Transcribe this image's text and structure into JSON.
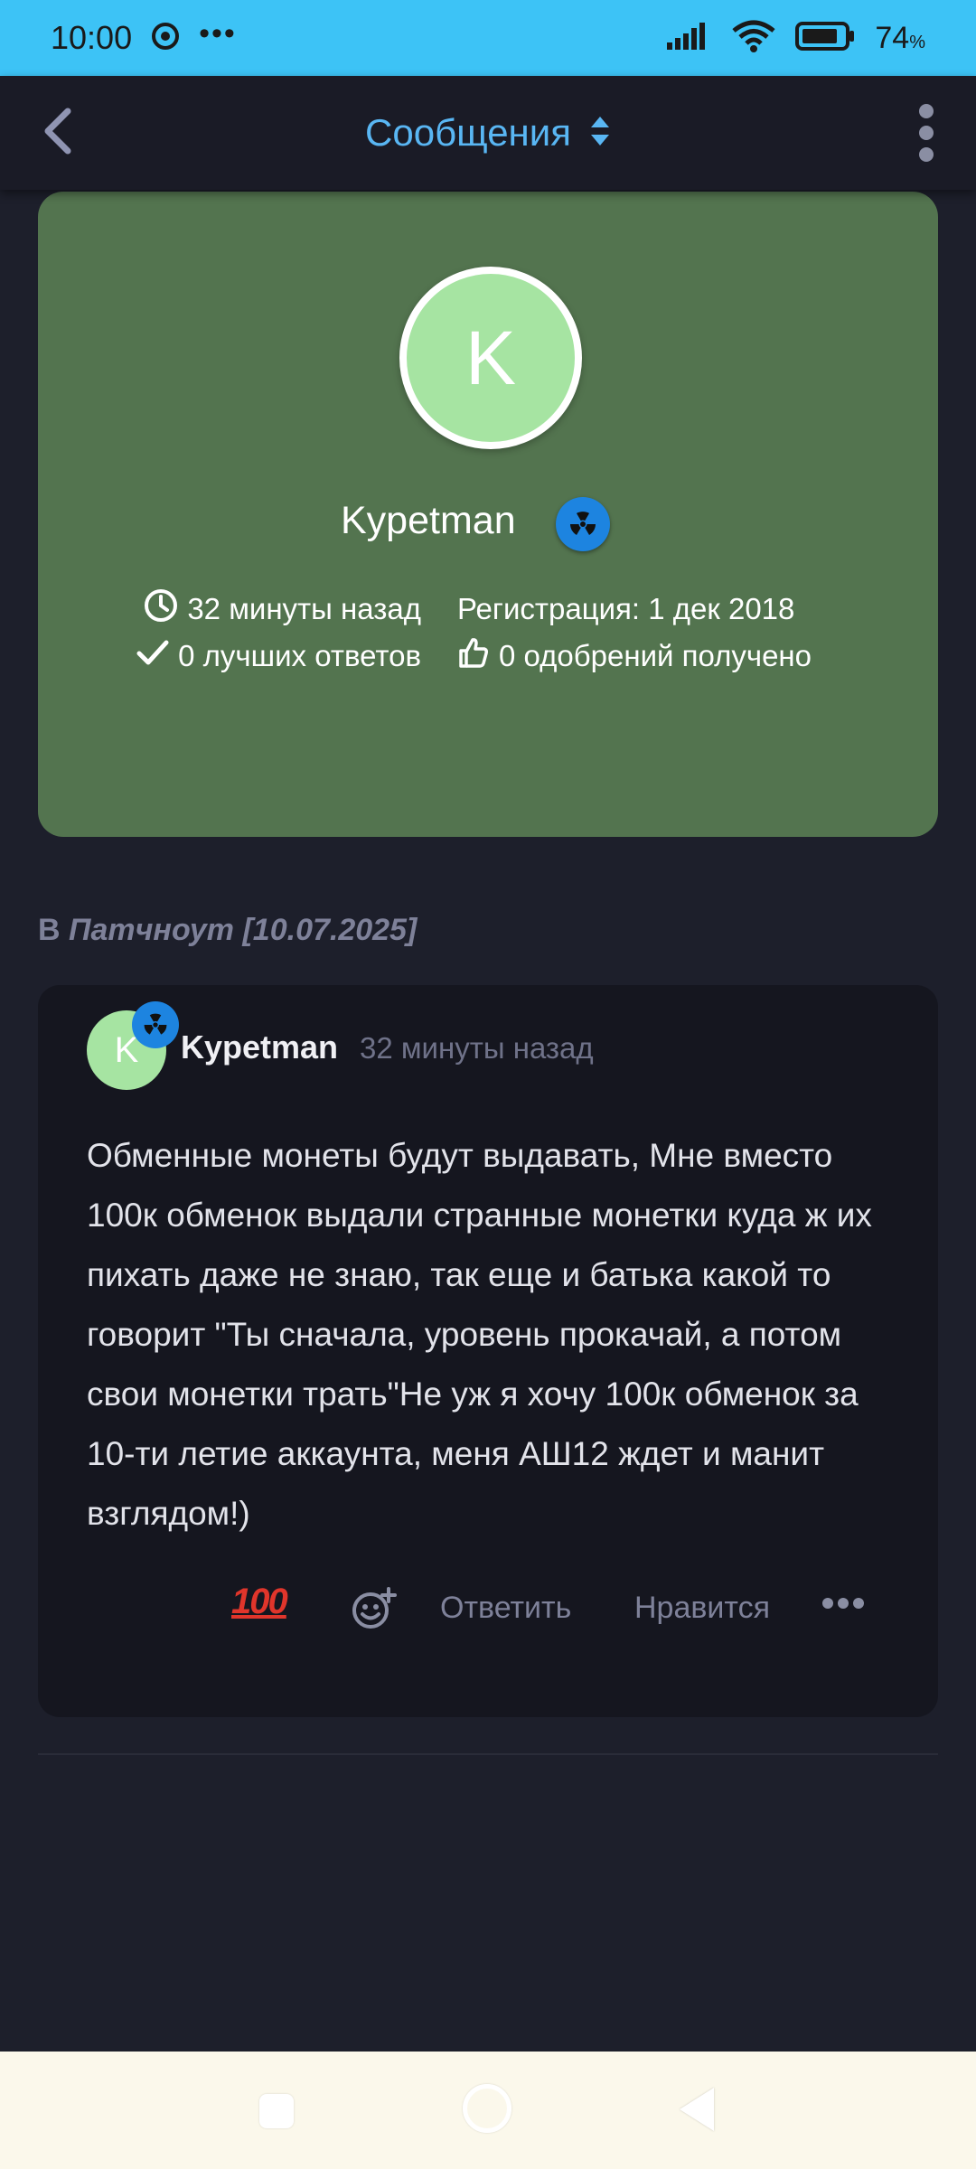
{
  "status_bar": {
    "time": "10:00",
    "overflow": "•••",
    "battery_percent": "74",
    "battery_unit": "%",
    "icons": [
      "chrome-icon",
      "signal-icon",
      "wifi-icon",
      "battery-icon"
    ]
  },
  "header": {
    "title": "Сообщения",
    "title_color": "#59b6f3",
    "icons": [
      "back-arrow-icon",
      "sort-arrows-icon",
      "more-vertical-icon"
    ]
  },
  "profile": {
    "avatar_letter": "K",
    "username": "Kypetman",
    "last_seen": "32 минуты назад",
    "registration": "Регистрация: 1 дек 2018",
    "best_answers": "0 лучших ответов",
    "likes_received": "0 одобрений получено",
    "card_color": "#53744f",
    "icons": [
      "radiation-badge-icon",
      "clock-icon",
      "check-icon",
      "thumbs-up-icon"
    ]
  },
  "thread": {
    "prefix": "В",
    "title": "Патчноут [10.07.2025]"
  },
  "post": {
    "avatar_letter": "K",
    "author": "Kypetman",
    "time": "32 минуты назад",
    "body": "Обменные монеты будут выдавать, Мне вместо 100к обменок выдали странные монетки куда ж их пихать даже не знаю, так еще и батька какой то говорит \"Ты сначала, уровень прокачай, а потом свои монетки трать\"Не уж я хочу 100к обменок за 10-ти летие аккаунта, меня АШ12 ждет и манит взглядом!)",
    "reaction": "100",
    "reply_label": "Ответить",
    "like_label": "Нравится",
    "icons": [
      "hundred-points-icon",
      "add-reaction-icon",
      "more-horizontal-icon"
    ]
  },
  "nav": {
    "icons": [
      "recents-square-icon",
      "home-circle-icon",
      "back-triangle-icon"
    ]
  }
}
